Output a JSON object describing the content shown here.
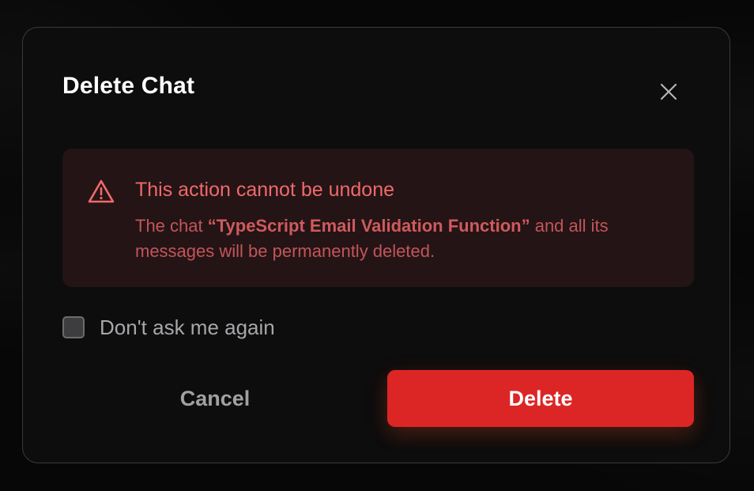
{
  "dialog": {
    "title": "Delete Chat",
    "close_icon": "close-icon",
    "warning": {
      "icon": "warning-triangle-icon",
      "heading": "This action cannot be undone",
      "body_prefix": "The chat ",
      "chat_name": "“TypeScript Email Validation Function”",
      "body_suffix": " and all its messages will be permanently deleted."
    },
    "checkbox": {
      "label": "Don't ask me again",
      "checked": false
    },
    "cancel_label": "Cancel",
    "delete_label": "Delete"
  },
  "colors": {
    "background": "#070707",
    "dialog_bg": "#0d0d0d",
    "dialog_border": "#3a3a3a",
    "warning_bg": "#241415",
    "warning_heading": "#f0696b",
    "warning_body": "#c2555a",
    "delete_button": "#dc2626",
    "muted_text": "#a1a1a5"
  }
}
